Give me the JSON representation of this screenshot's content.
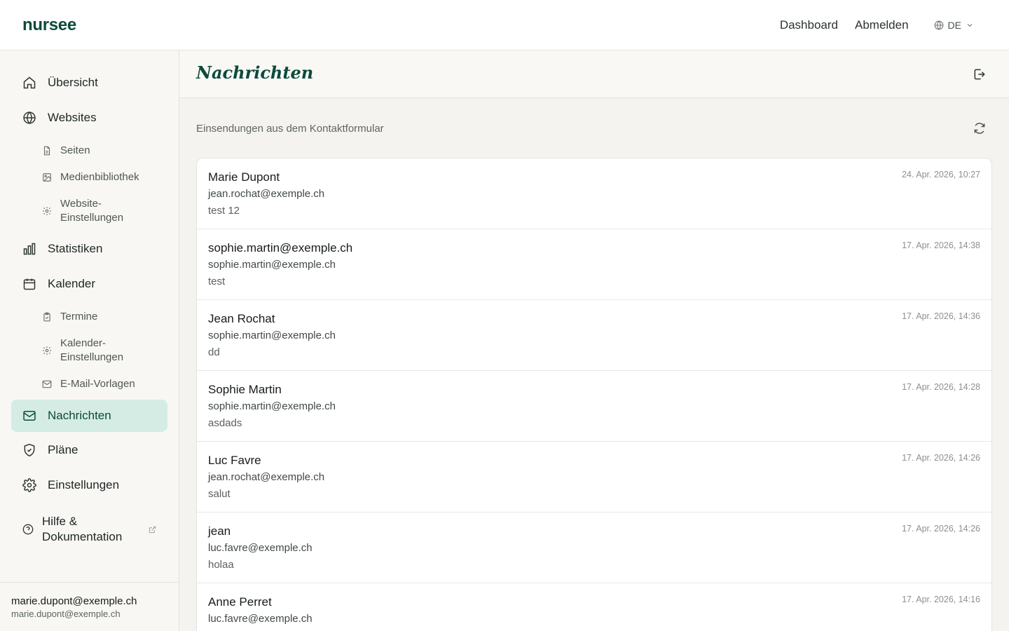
{
  "app": {
    "logo": "nursee"
  },
  "topnav": {
    "dashboard": "Dashboard",
    "logout": "Abmelden",
    "language": "DE"
  },
  "sidebar": {
    "overview": "Übersicht",
    "websites": "Websites",
    "pages": "Seiten",
    "media": "Medienbibliothek",
    "website_settings_1": "Website-",
    "website_settings_2": "Einstellungen",
    "statistics": "Statistiken",
    "calendar": "Kalender",
    "appointments": "Termine",
    "calendar_settings_1": "Kalender-",
    "calendar_settings_2": "Einstellungen",
    "email_templates": "E-Mail-Vorlagen",
    "messages": "Nachrichten",
    "plans": "Pläne",
    "settings": "Einstellungen",
    "help_1": "Hilfe &",
    "help_2": "Dokumentation"
  },
  "user": {
    "name": "marie.dupont@exemple.ch",
    "email": "marie.dupont@exemple.ch"
  },
  "main": {
    "title": "Nachrichten",
    "subtitle": "Einsendungen aus dem Kontaktformular",
    "messages": [
      {
        "name": "Marie Dupont",
        "email": "jean.rochat@exemple.ch",
        "text": "test 12",
        "date": "24. Apr. 2026, 10:27"
      },
      {
        "name": "sophie.martin@exemple.ch",
        "email": "sophie.martin@exemple.ch",
        "text": "test",
        "date": "17. Apr. 2026, 14:38"
      },
      {
        "name": "Jean Rochat",
        "email": "sophie.martin@exemple.ch",
        "text": "dd",
        "date": "17. Apr. 2026, 14:36"
      },
      {
        "name": "Sophie Martin",
        "email": "sophie.martin@exemple.ch",
        "text": "asdads",
        "date": "17. Apr. 2026, 14:28"
      },
      {
        "name": "Luc Favre",
        "email": "jean.rochat@exemple.ch",
        "text": "salut",
        "date": "17. Apr. 2026, 14:26"
      },
      {
        "name": "jean",
        "email": "luc.favre@exemple.ch",
        "text": "holaa",
        "date": "17. Apr. 2026, 14:26"
      },
      {
        "name": "Anne Perret",
        "email": "luc.favre@exemple.ch",
        "text": "",
        "date": "17. Apr. 2026, 14:16"
      }
    ]
  },
  "colors": {
    "brand": "#0c4a3c",
    "active_bg": "#d4ece4",
    "page_bg": "#f4f3f0"
  },
  "icons": [
    "home-icon",
    "globe-icon",
    "file-icon",
    "image-icon",
    "gear-icon",
    "bar-chart-icon",
    "calendar-icon",
    "clipboard-icon",
    "mail-icon",
    "shield-icon",
    "help-circle-icon",
    "external-link-icon",
    "logout-icon",
    "refresh-icon",
    "chevron-down-icon"
  ]
}
